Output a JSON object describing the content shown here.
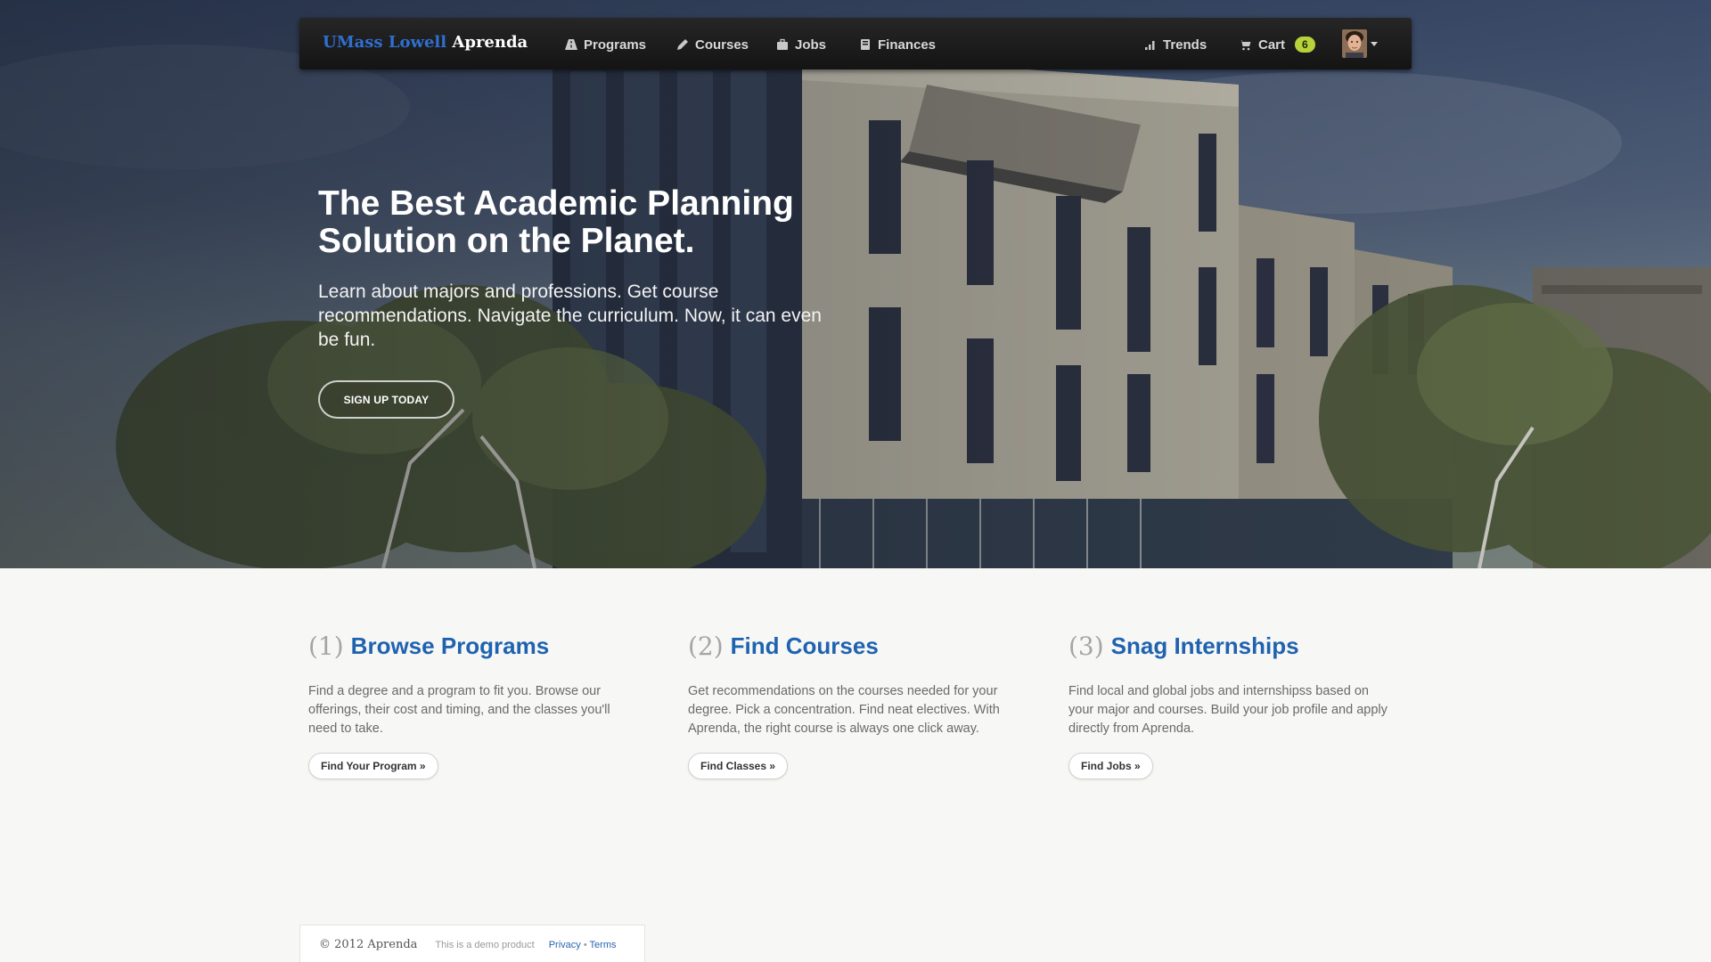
{
  "navbar": {
    "brand_part1": "UMass Lowell",
    "brand_part2": "Aprenda",
    "items": [
      {
        "label": "Programs",
        "icon": "road-icon"
      },
      {
        "label": "Courses",
        "icon": "pencil-icon"
      },
      {
        "label": "Jobs",
        "icon": "briefcase-icon"
      },
      {
        "label": "Finances",
        "icon": "book-icon"
      }
    ],
    "right": {
      "trends": {
        "label": "Trends",
        "icon": "bar-chart-icon"
      },
      "cart": {
        "label": "Cart",
        "icon": "cart-icon",
        "count": "6"
      }
    }
  },
  "hero": {
    "title": "The Best Academic Planning Solution on the Planet.",
    "subtitle": "Learn about majors and professions. Get course recommendations. Navigate the curriculum. Now, it can even be fun.",
    "cta": "SIGN UP TODAY"
  },
  "features": [
    {
      "num": "(1)",
      "title": "Browse Programs",
      "text": "Find a degree and a program to fit you. Browse our offerings, their cost and timing, and the classes you'll need to take.",
      "button": "Find Your Program »"
    },
    {
      "num": "(2)",
      "title": "Find Courses",
      "text": "Get recommendations on the courses needed for your degree. Pick a concentration. Find neat electives. With Aprenda, the right course is always one click away.",
      "button": "Find Classes »"
    },
    {
      "num": "(3)",
      "title": "Snag Internships",
      "text": "Find local and global jobs and internshipss based on your major and courses. Build your job profile and apply directly from Aprenda.",
      "button": "Find Jobs »"
    }
  ],
  "footer": {
    "copyright": "© 2012 Aprenda",
    "demo": "This is a demo product",
    "privacy": "Privacy",
    "sep": "•",
    "terms": "Terms"
  },
  "colors": {
    "brand_blue": "#2f6fd0",
    "feature_title": "#1f63b0",
    "badge": "#b7d23a",
    "link": "#2a65b1"
  }
}
